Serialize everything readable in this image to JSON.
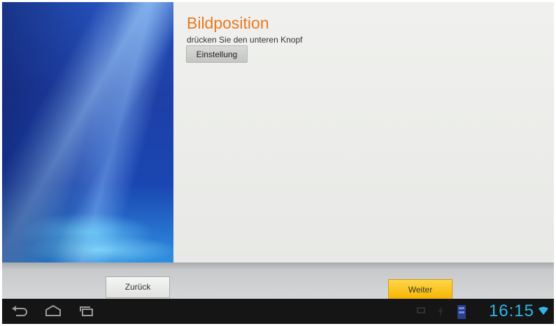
{
  "screen": {
    "title": "Bildposition",
    "subtitle": "drücken Sie den unteren Knopf",
    "settings_button": "Einstellung"
  },
  "footer": {
    "back_button": "Zurück",
    "next_button": "Weiter"
  },
  "system_bar": {
    "clock": "16:15",
    "icons": [
      "back-icon",
      "home-icon",
      "recent-apps-icon",
      "screen-icon",
      "usb-icon",
      "notification-icon",
      "wifi-icon"
    ]
  },
  "colors": {
    "title": "#e8791f",
    "accent": "#33b5e5",
    "next_button": "#f6b400"
  }
}
